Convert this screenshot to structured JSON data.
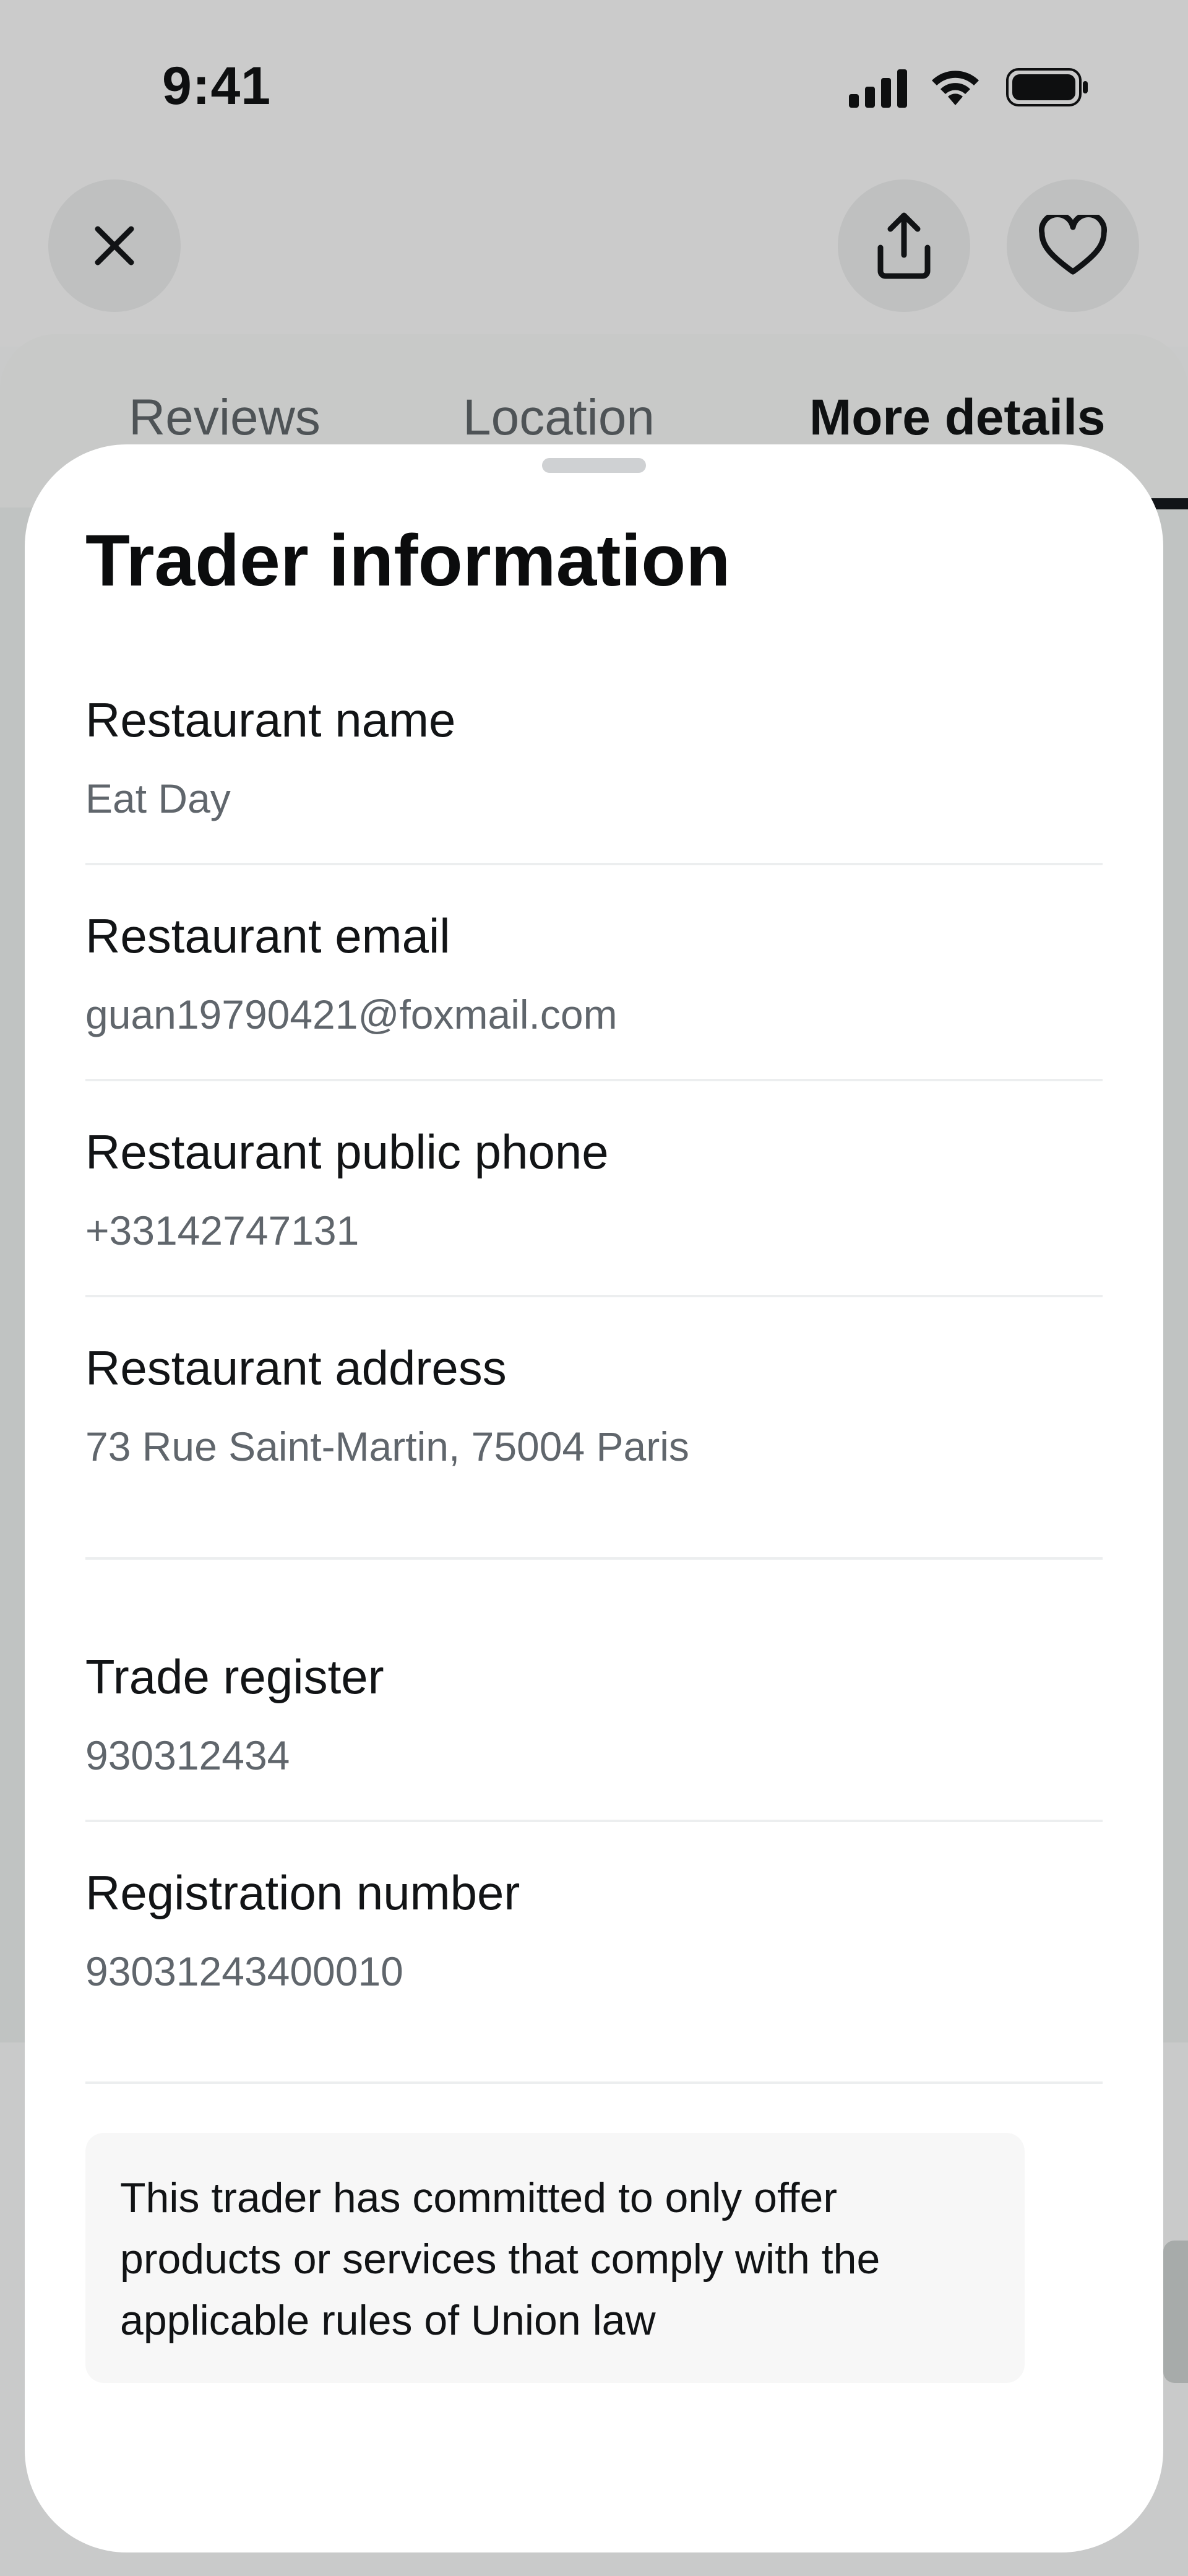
{
  "status_bar": {
    "time": "9:41"
  },
  "header": {
    "close_icon": "close-icon",
    "share_icon": "share-icon",
    "favorite_icon": "heart-icon"
  },
  "tabs": [
    {
      "label": "Reviews",
      "active": false
    },
    {
      "label": "Location",
      "active": false
    },
    {
      "label": "More details",
      "active": true
    }
  ],
  "sheet": {
    "title": "Trader information",
    "fields": [
      {
        "label": "Restaurant name",
        "value": "Eat Day"
      },
      {
        "label": "Restaurant email",
        "value": "guan19790421@foxmail.com"
      },
      {
        "label": "Restaurant public phone",
        "value": "+33142747131"
      },
      {
        "label": "Restaurant address",
        "value": "73 Rue Saint-Martin, 75004 Paris"
      },
      {
        "label": "Trade register",
        "value": "930312434"
      },
      {
        "label": "Registration number",
        "value": "93031243400010"
      }
    ],
    "notice": "This trader has committed to only offer products or services that comply with the applicable rules of Union law"
  },
  "colors": {
    "overlay_background": "#c9caca",
    "sheet_background": "#ffffff",
    "label_text": "#121416",
    "value_text": "#60666c",
    "notice_background": "#f7f7f7"
  }
}
